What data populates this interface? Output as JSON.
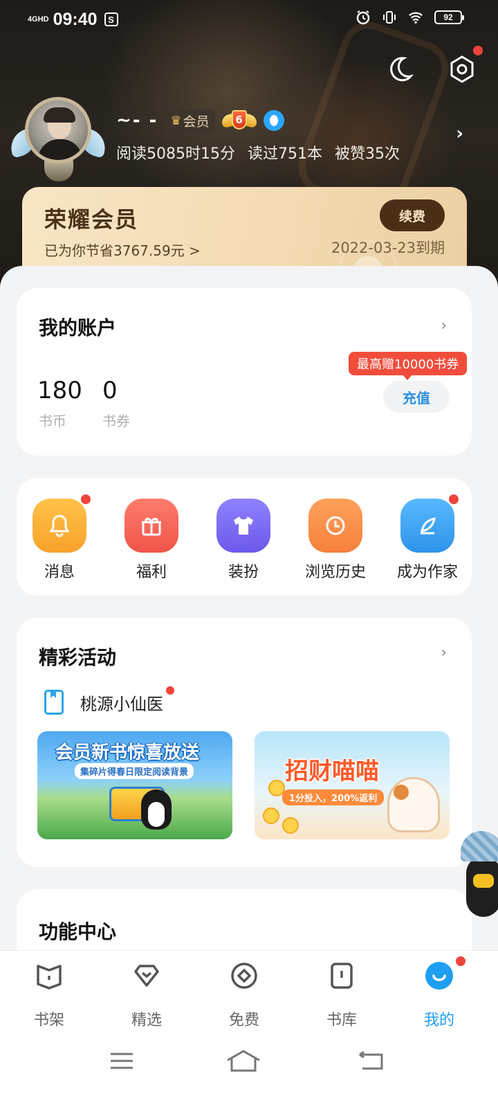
{
  "status_bar": {
    "network": "4GHD",
    "time": "09:40",
    "sim_badge": "S",
    "battery": "92"
  },
  "profile": {
    "username": "~- -",
    "vip_tag": "会员",
    "level": "6",
    "stats": {
      "read_time": "阅读5085时15分",
      "books_read": "读过751本",
      "likes": "被赞35次"
    }
  },
  "vip_card": {
    "title": "荣耀会员",
    "saved": "已为你节省3767.59元 >",
    "renew_label": "续费",
    "expire": "2022-03-23到期"
  },
  "account": {
    "title": "我的账户",
    "coins_value": "180",
    "coins_label": "书币",
    "vouchers_value": "0",
    "vouchers_label": "书券",
    "promo": "最高赠10000书券",
    "recharge_label": "充值"
  },
  "shortcuts": [
    {
      "label": "消息",
      "icon": "bell-icon",
      "color": "#fbb03b",
      "dot": true
    },
    {
      "label": "福利",
      "icon": "gift-icon",
      "color": "#f56a5e",
      "dot": false
    },
    {
      "label": "装扮",
      "icon": "tshirt-icon",
      "color": "#7d6cf0",
      "dot": false
    },
    {
      "label": "浏览历史",
      "icon": "clock-icon",
      "color": "#f9904c",
      "dot": false
    },
    {
      "label": "成为作家",
      "icon": "feather-icon",
      "color": "#3ea6f2",
      "dot": true
    }
  ],
  "activities": {
    "title": "精彩活动",
    "item_label": "桃源小仙医",
    "banner1_title": "会员新书惊喜放送",
    "banner1_sub": "集碎片得春日限定阅读背景",
    "banner2_title": "招财喵喵",
    "banner2_sub": "1分投入，200%返利"
  },
  "functions": {
    "title": "功能中心"
  },
  "tabbar": [
    {
      "label": "书架",
      "icon": "bookshelf-icon",
      "active": false
    },
    {
      "label": "精选",
      "icon": "featured-icon",
      "active": false
    },
    {
      "label": "免费",
      "icon": "free-icon",
      "active": false
    },
    {
      "label": "书库",
      "icon": "library-icon",
      "active": false
    },
    {
      "label": "我的",
      "icon": "me-icon",
      "active": true
    }
  ],
  "colors": {
    "accent": "#1e9ff2",
    "red_dot": "#f0443a",
    "vip_dark": "#4a2f17"
  }
}
